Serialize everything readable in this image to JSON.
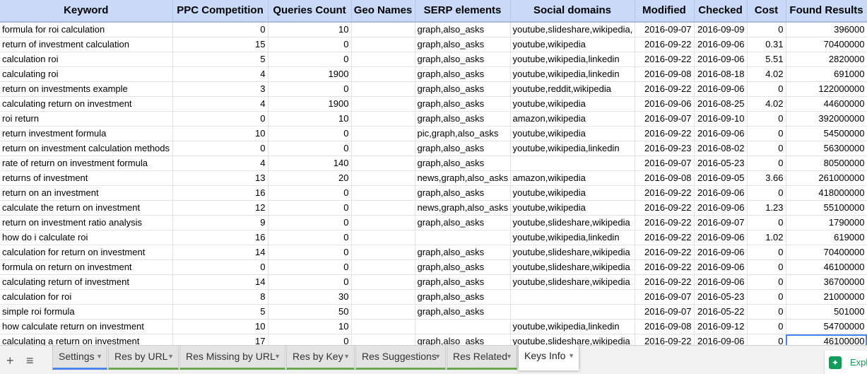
{
  "sheet": {
    "columns": [
      "Keyword",
      "PPC Competition",
      "Queries Count",
      "Geo Names",
      "SERP elements",
      "Social domains",
      "Modified",
      "Checked",
      "Cost",
      "Found Results"
    ],
    "rows": [
      [
        "formula for roi calculation",
        "0",
        "10",
        "",
        "graph,also_asks",
        "youtube,slideshare,wikipedia,",
        "2016-09-07",
        "2016-09-09",
        "0",
        "396000"
      ],
      [
        "return of investment calculation",
        "15",
        "0",
        "",
        "graph,also_asks",
        "youtube,wikipedia",
        "2016-09-22",
        "2016-09-06",
        "0.31",
        "70400000"
      ],
      [
        "calculation roi",
        "5",
        "0",
        "",
        "graph,also_asks",
        "youtube,wikipedia,linkedin",
        "2016-09-22",
        "2016-09-06",
        "5.51",
        "2820000"
      ],
      [
        "calculating roi",
        "4",
        "1900",
        "",
        "graph,also_asks",
        "youtube,wikipedia,linkedin",
        "2016-09-08",
        "2016-08-18",
        "4.02",
        "691000"
      ],
      [
        "return on investments example",
        "3",
        "0",
        "",
        "graph,also_asks",
        "youtube,reddit,wikipedia",
        "2016-09-22",
        "2016-09-06",
        "0",
        "122000000"
      ],
      [
        "calculating return on investment",
        "4",
        "1900",
        "",
        "graph,also_asks",
        "youtube,wikipedia",
        "2016-09-06",
        "2016-08-25",
        "4.02",
        "44600000"
      ],
      [
        "roi return",
        "0",
        "10",
        "",
        "graph,also_asks",
        "amazon,wikipedia",
        "2016-09-07",
        "2016-09-10",
        "0",
        "392000000"
      ],
      [
        "return investment formula",
        "10",
        "0",
        "",
        "pic,graph,also_asks",
        "youtube,wikipedia",
        "2016-09-22",
        "2016-09-06",
        "0",
        "54500000"
      ],
      [
        "return on investment calculation methods",
        "0",
        "0",
        "",
        "graph,also_asks",
        "youtube,wikipedia,linkedin",
        "2016-09-23",
        "2016-08-02",
        "0",
        "56300000"
      ],
      [
        "rate of return on investment formula",
        "4",
        "140",
        "",
        "graph,also_asks",
        "",
        "2016-09-07",
        "2016-05-23",
        "0",
        "80500000"
      ],
      [
        "returns of investment",
        "13",
        "20",
        "",
        "news,graph,also_asks",
        "amazon,wikipedia",
        "2016-09-08",
        "2016-09-05",
        "3.66",
        "261000000"
      ],
      [
        "return on an investment",
        "16",
        "0",
        "",
        "graph,also_asks",
        "youtube,wikipedia",
        "2016-09-22",
        "2016-09-06",
        "0",
        "418000000"
      ],
      [
        "calculate the return on investment",
        "12",
        "0",
        "",
        "news,graph,also_asks",
        "youtube,wikipedia",
        "2016-09-22",
        "2016-09-06",
        "1.23",
        "55100000"
      ],
      [
        "return on investment ratio analysis",
        "9",
        "0",
        "",
        "graph,also_asks",
        "youtube,slideshare,wikipedia",
        "2016-09-22",
        "2016-09-07",
        "0",
        "1790000"
      ],
      [
        "how do i calculate roi",
        "16",
        "0",
        "",
        "",
        "youtube,wikipedia,linkedin",
        "2016-09-22",
        "2016-09-06",
        "1.02",
        "619000"
      ],
      [
        "calculation for return on investment",
        "14",
        "0",
        "",
        "graph,also_asks",
        "youtube,slideshare,wikipedia",
        "2016-09-22",
        "2016-09-06",
        "0",
        "70400000"
      ],
      [
        "formula on return on investment",
        "0",
        "0",
        "",
        "graph,also_asks",
        "youtube,slideshare,wikipedia",
        "2016-09-22",
        "2016-09-06",
        "0",
        "46100000"
      ],
      [
        "calculating return of investment",
        "14",
        "0",
        "",
        "graph,also_asks",
        "youtube,slideshare,wikipedia",
        "2016-09-22",
        "2016-09-06",
        "0",
        "36700000"
      ],
      [
        "calculation for roi",
        "8",
        "30",
        "",
        "graph,also_asks",
        "",
        "2016-09-07",
        "2016-05-23",
        "0",
        "21000000"
      ],
      [
        "simple roi formula",
        "5",
        "50",
        "",
        "graph,also_asks",
        "",
        "2016-09-07",
        "2016-05-22",
        "0",
        "501000"
      ],
      [
        "how calculate return on investment",
        "10",
        "10",
        "",
        "",
        "youtube,wikipedia,linkedin",
        "2016-09-08",
        "2016-09-12",
        "0",
        "54700000"
      ],
      [
        "calculating a return on investment",
        "17",
        "0",
        "",
        "graph,also_asks",
        "youtube,slideshare,wikipedia",
        "2016-09-22",
        "2016-09-06",
        "0",
        "46100000"
      ]
    ]
  },
  "tabs": [
    {
      "label": "Settings"
    },
    {
      "label": "Res by URL"
    },
    {
      "label": "Res Missing by URL"
    },
    {
      "label": "Res by Key"
    },
    {
      "label": "Res Suggestions"
    },
    {
      "label": "Res Related"
    },
    {
      "label": "Keys Info"
    }
  ],
  "active_tab": "Keys Info",
  "icons": {
    "add_sheet": "plus-icon",
    "all_sheets": "menu-icon",
    "tab_menu": "caret-down-icon",
    "explore": "explore-icon"
  },
  "explore_label": "Explo",
  "colors": {
    "header_bg": "#c9daf8",
    "tab_accent_green": "#6aa84f",
    "tab_accent_blue": "#4a86e8",
    "selection": "#4285f4",
    "explore": "#0f9d58"
  }
}
